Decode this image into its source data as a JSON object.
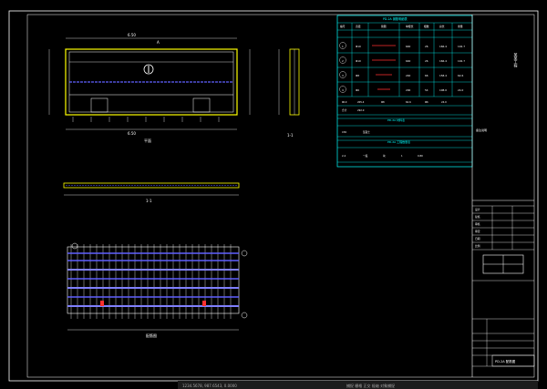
{
  "drawing": {
    "plan_view": {
      "top_dim": "6.50",
      "label_a": "A",
      "bottom_dim": "6.50",
      "caption": "平面"
    },
    "side_view": {
      "caption": "1-1"
    },
    "profile_view": {
      "caption": "1-1"
    },
    "rebar_view": {
      "caption": "配筋图"
    }
  },
  "rebar_table": {
    "title": "PD-2A 钢筋明细表",
    "headers": [
      "编号",
      "直径",
      "简图",
      "单根长",
      "根数",
      "总长",
      "重量"
    ],
    "rows": [
      [
        "1",
        "Φ10",
        "",
        "640",
        "26",
        "166.4",
        "102.7"
      ],
      [
        "2",
        "Φ10",
        "",
        "640",
        "26",
        "166.4",
        "102.7"
      ],
      [
        "3",
        "Φ8",
        "",
        "240",
        "66",
        "158.4",
        "62.6"
      ],
      [
        "4",
        "Φ6",
        "",
        "200",
        "54",
        "108.0",
        "24.0"
      ]
    ],
    "summary_rows": [
      [
        "Φ10",
        "205.4",
        "Φ8",
        "62.6",
        "Φ6",
        "24.0"
      ],
      [
        "合计",
        "292.0",
        "",
        "",
        "",
        ""
      ]
    ],
    "material_title": "PD-2A 材料表",
    "material_rows": [
      [
        "C30",
        "混凝土",
        "",
        "",
        "",
        ""
      ]
    ],
    "note_title": "PD-2A 工程数量表",
    "note_rows": [
      [
        "2-2",
        "一般",
        "块",
        "1",
        "0.80",
        ""
      ]
    ],
    "remark": "备注说明"
  },
  "title_block": {
    "vertical_title": "某某工程",
    "drawing_name": "PD-2A 配筋图",
    "label_rows": [
      "设计",
      "复核",
      "审核",
      "审定",
      "日期",
      "比例"
    ]
  },
  "status_bar": {
    "coords": "1234.5678, 987.6543, 0.0000",
    "modes": "捕捉 栅格 正交 极轴 对象捕捉"
  },
  "colors": {
    "frame": "#ffffff",
    "table": "#00ffff",
    "slab": "#ffff00",
    "rebar": "#4040ff",
    "accent": "#ff3030"
  }
}
